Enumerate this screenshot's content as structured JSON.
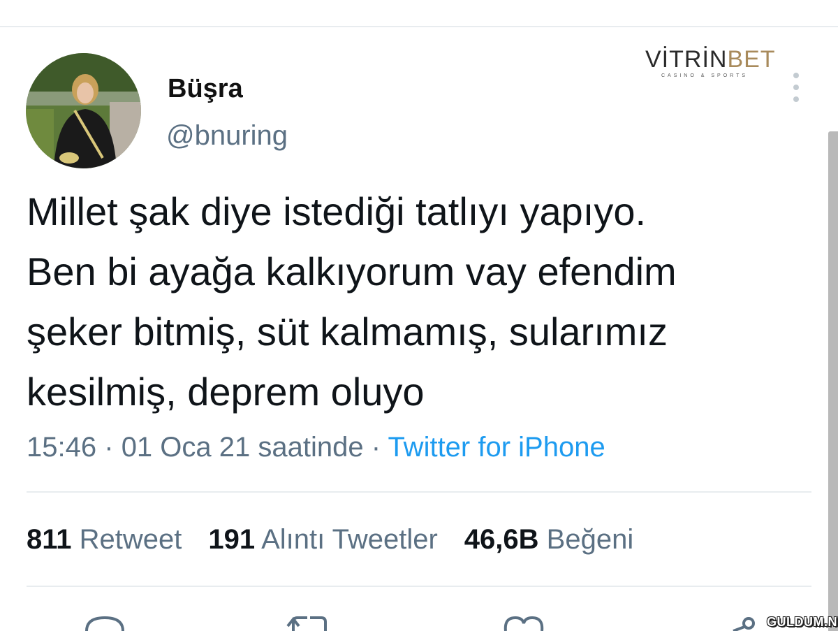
{
  "user": {
    "display_name": "Büşra",
    "handle": "@bnuring"
  },
  "watermark": {
    "brand_main": "VİTRİN",
    "brand_accent": "BET",
    "tagline": "CASINO & SPORTS"
  },
  "tweet": {
    "text": "Millet şak diye istediği tatlıyı yapıyo.\nBen bi ayağa kalkıyorum vay efendim\nşeker bitmiş, süt kalmamış, sularımız\nkesilmiş, deprem oluyo",
    "time": "15:46",
    "date": "01 Oca 21 saatinde",
    "separator": "·",
    "source": "Twitter for iPhone"
  },
  "stats": [
    {
      "count": "811",
      "label": "Retweet"
    },
    {
      "count": "191",
      "label": "Alıntı Tweetler"
    },
    {
      "count": "46,6B",
      "label": "Beğeni"
    }
  ],
  "actions": [
    "reply-icon",
    "retweet-icon",
    "like-icon",
    "share-icon"
  ],
  "site_watermark": "GULDUM.NET",
  "colors": {
    "text": "#0f1419",
    "secondary": "#5b7083",
    "link": "#1d9bf0",
    "divider": "#e8ecef"
  }
}
